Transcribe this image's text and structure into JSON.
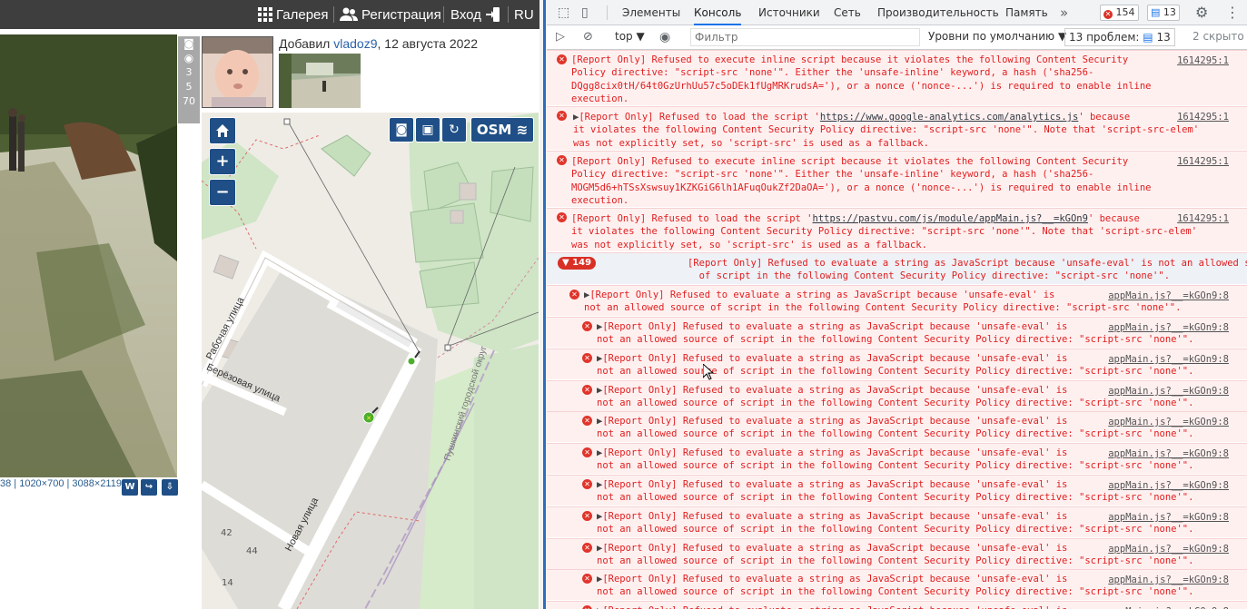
{
  "site": {
    "nav": {
      "gallery": "Галерея",
      "register": "Регистрация",
      "login": "Вход",
      "lang": "RU"
    },
    "photo_side": {
      "count1": "3",
      "count2": "5",
      "count3": "70"
    },
    "photo_info": "38 | 1020×700 | 3088×2119",
    "buttons": {
      "w": "W"
    },
    "author": {
      "prefix": "Добавил",
      "user": "vladoz9",
      "date": ", 12 августа 2022"
    },
    "map": {
      "osm_label": "OSM",
      "zoom_in": "+",
      "zoom_out": "−",
      "streets": {
        "rabochaya": "Рабочая улица",
        "berezovaya": "Берёзовая улица",
        "novaya": "Новая улица",
        "pushkinsky": "Пушкинский городской округ"
      },
      "house_numbers": [
        "42",
        "44",
        "14"
      ]
    }
  },
  "devtools": {
    "tabs": [
      "Элементы",
      "Консоль",
      "Источники",
      "Сеть",
      "Производительность",
      "Память"
    ],
    "active_tab": "Консоль",
    "error_count": "154",
    "message_count": "13",
    "toolbar": {
      "context": "top",
      "filter_placeholder": "Фильтр",
      "levels": "Уровни по умолчанию",
      "issues": "13 проблем:",
      "issues_count": "13",
      "hidden": "2 скрыто"
    },
    "messages": [
      {
        "lines": [
          "[Report Only] Refused to execute inline script because it violates the following Content Security",
          "Policy directive: \"script-src 'none'\". Either the 'unsafe-inline' keyword, a hash ('sha256-",
          "DQgg8cix0tH/64t0GzUrhUu57c5oDEk1fUgMRKrudsA='), or a nonce ('nonce-...') is required to enable inline",
          "execution."
        ],
        "source": "1614295:1"
      },
      {
        "lines": [
          "[Report Only] Refused to load the script 'https://www.google-analytics.com/analytics.js' because",
          "it violates the following Content Security Policy directive: \"script-src 'none'\". Note that 'script-src-elem'",
          "was not explicitly set, so 'script-src' is used as a fallback."
        ],
        "link": "https://www.google-analytics.com/analytics.js",
        "source": "1614295:1"
      },
      {
        "lines": [
          "[Report Only] Refused to execute inline script because it violates the following Content Security",
          "Policy directive: \"script-src 'none'\". Either the 'unsafe-inline' keyword, a hash ('sha256-",
          "MOGM5d6+hTSsXswsuy1KZKGiG6lh1AFuqOukZf2DaOA='), or a nonce ('nonce-...') is required to enable inline",
          "execution."
        ],
        "source": "1614295:1"
      },
      {
        "lines": [
          "[Report Only] Refused to load the script 'https://pastvu.com/js/module/appMain.js?__=kGOn9' because",
          "it violates the following Content Security Policy directive: \"script-src 'none'\". Note that 'script-src-elem'",
          "was not explicitly set, so 'script-src' is used as a fallback."
        ],
        "link": "https://pastvu.com/js/module/appMain.js?__=kGOn9",
        "source": "1614295:1"
      }
    ],
    "group": {
      "count": "149",
      "lines": [
        "[Report Only] Refused to evaluate a string as JavaScript because 'unsafe-eval' is not an allowed source",
        "of script in the following Content Security Policy directive: \"script-src 'none'\"."
      ]
    },
    "eval_message": {
      "line1": "[Report Only] Refused to evaluate a string as JavaScript because 'unsafe-eval' is",
      "line2": "not an allowed source of script in the following Content Security Policy directive: \"script-src 'none'\".",
      "source": "appMain.js?__=kGOn9:8"
    }
  }
}
